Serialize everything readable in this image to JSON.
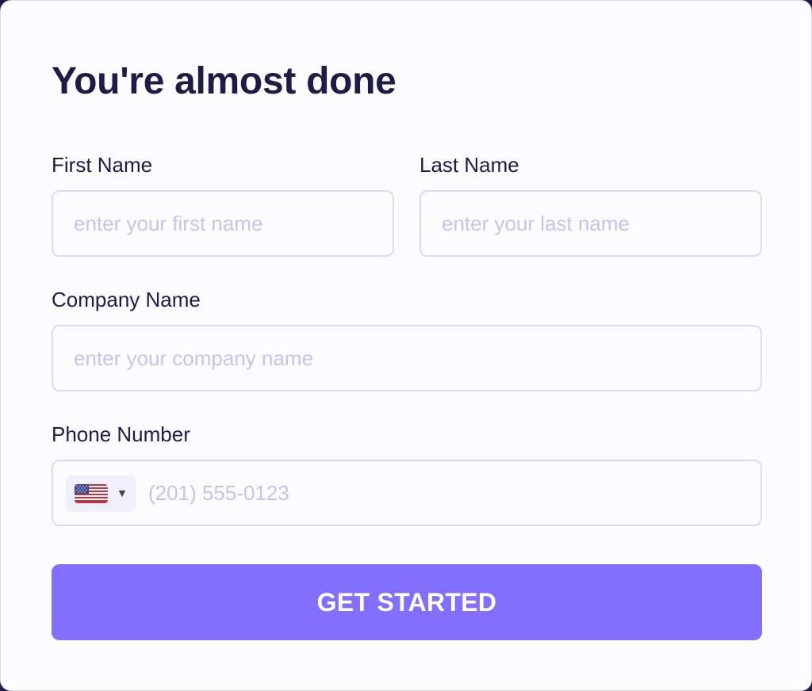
{
  "form": {
    "title": "You're almost done",
    "first_name": {
      "label": "First Name",
      "placeholder": "enter your first name",
      "value": ""
    },
    "last_name": {
      "label": "Last Name",
      "placeholder": "enter your last name",
      "value": ""
    },
    "company_name": {
      "label": "Company Name",
      "placeholder": "enter your company name",
      "value": ""
    },
    "phone": {
      "label": "Phone Number",
      "placeholder": "(201) 555-0123",
      "value": "",
      "country_icon": "us-flag-icon",
      "dropdown_icon": "caret-down-icon"
    },
    "submit_label": "GET STARTED"
  },
  "colors": {
    "accent": "#836fff",
    "text": "#1e1b47",
    "placeholder": "#c9c2ea",
    "border": "#dedbef",
    "background": "#fcfcfe"
  }
}
